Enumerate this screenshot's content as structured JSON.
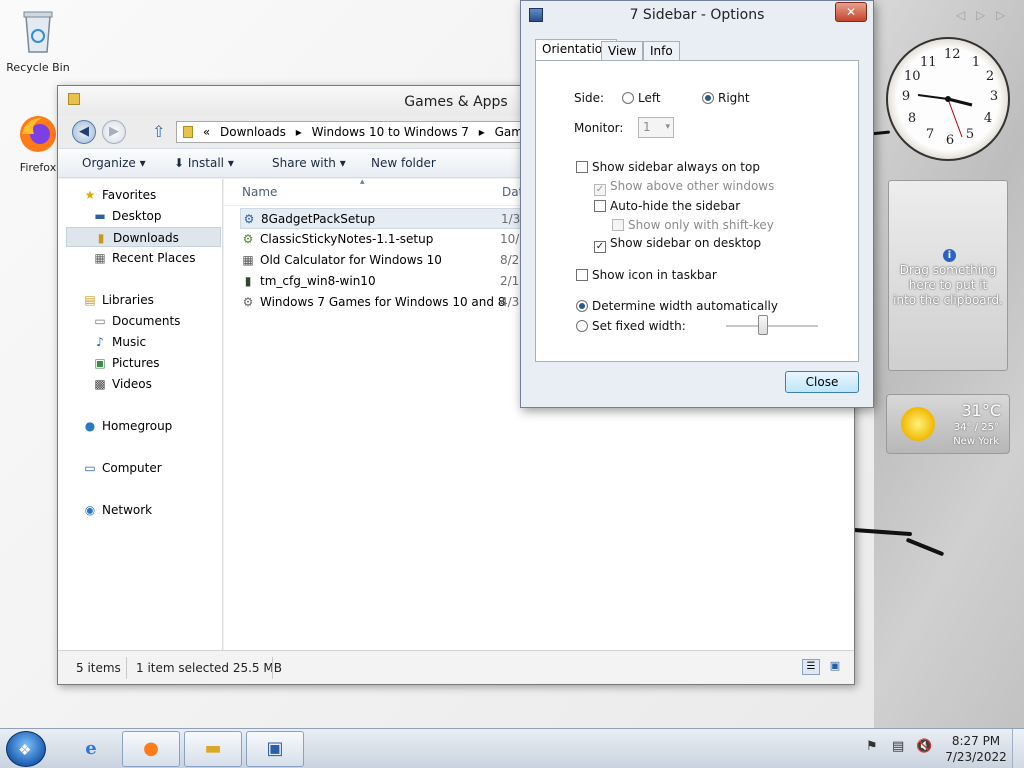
{
  "desktop": {
    "icons": [
      {
        "label": "Recycle Bin",
        "icon": "recycle-bin-icon"
      },
      {
        "label": "Firefox",
        "icon": "firefox-icon"
      }
    ]
  },
  "explorer": {
    "title": "Games & Apps",
    "nav_back": "back",
    "nav_forward": "forward",
    "breadcrumb": {
      "overflow": "«",
      "items": [
        "Downloads",
        "Windows 10 to Windows 7",
        "Games & Ap"
      ]
    },
    "toolbar": {
      "organize": "Organize",
      "install": "Install",
      "share_with": "Share with",
      "new_folder": "New folder"
    },
    "nav": {
      "favorites": "Favorites",
      "desktop": "Desktop",
      "downloads": "Downloads",
      "recent": "Recent Places",
      "libraries": "Libraries",
      "documents": "Documents",
      "music": "Music",
      "pictures": "Pictures",
      "videos": "Videos",
      "homegroup": "Homegroup",
      "computer": "Computer",
      "network": "Network"
    },
    "columns": {
      "name": "Name",
      "date": "Dat"
    },
    "files": [
      {
        "name": "8GadgetPackSetup",
        "date": "1/3"
      },
      {
        "name": "ClassicStickyNotes-1.1-setup",
        "date": "10/"
      },
      {
        "name": "Old Calculator for Windows 10",
        "date": "8/2"
      },
      {
        "name": "tm_cfg_win8-win10",
        "date": "2/1"
      },
      {
        "name": "Windows 7 Games for Windows 10 and 8",
        "date": "4/3"
      }
    ],
    "status": {
      "items": "5 items",
      "selected": "1 item selected  25.5 MB"
    }
  },
  "dialog": {
    "title": "7 Sidebar - Options",
    "close_x": "✕",
    "tabs": [
      "Orientation",
      "View",
      "Info"
    ],
    "side_label": "Side:",
    "left": "Left",
    "right": "Right",
    "monitor_label": "Monitor:",
    "monitor_value": "1",
    "always_on_top": "Show sidebar always on top",
    "above_other": "Show above other windows",
    "autohide": "Auto-hide the sidebar",
    "shift_key": "Show only with shift-key",
    "on_desktop": "Show sidebar on desktop",
    "icon_taskbar": "Show icon in taskbar",
    "width_auto": "Determine width automatically",
    "width_fixed": "Set fixed width:",
    "close_button": "Close"
  },
  "gadgets": {
    "clock_numbers": [
      "12",
      "1",
      "2",
      "3",
      "4",
      "5",
      "6",
      "7",
      "8",
      "9",
      "10",
      "11"
    ],
    "clipboard_text": [
      "Drag something",
      "here to put it",
      "into the clipboard."
    ],
    "weather": {
      "temp": "31°C",
      "range": "34° / 25°",
      "city": "New York"
    }
  },
  "taskbar": {
    "time": "8:27 PM",
    "date": "7/23/2022"
  }
}
